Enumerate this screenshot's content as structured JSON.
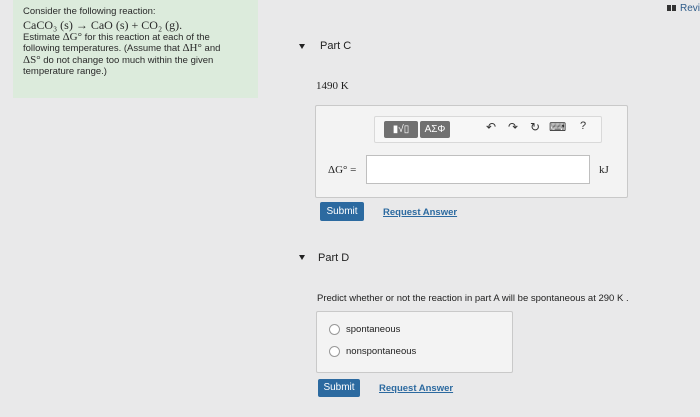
{
  "problem": {
    "line1": "Consider the following reaction:",
    "reaction": "CaCO₃ (s) → CaO (s) + CO₂ (g).",
    "line3a": "Estimate ",
    "dg": "ΔG°",
    "line3b": " for this reaction at each of the",
    "line4a": "following temperatures. (Assume that ",
    "dh": "ΔH°",
    "line4b": " and",
    "ds": "ΔS°",
    "line5b": " do not change too much within the given",
    "line6": "temperature range.)"
  },
  "header": {
    "review_label": "Revi"
  },
  "partC": {
    "title": "Part C",
    "temperature": "1490 K",
    "delta_g_label": "ΔG° =",
    "unit": "kJ",
    "toolbar": {
      "templates_label": "▮√▯",
      "greek_label": "ΑΣΦ",
      "help_label": "?"
    },
    "submit_label": "Submit",
    "request_label": "Request Answer"
  },
  "partD": {
    "title": "Part D",
    "question": "Predict whether or not the reaction in part A will be spontaneous at 290 K .",
    "options": [
      "spontaneous",
      "nonspontaneous"
    ],
    "submit_label": "Submit",
    "request_label": "Request Answer"
  }
}
